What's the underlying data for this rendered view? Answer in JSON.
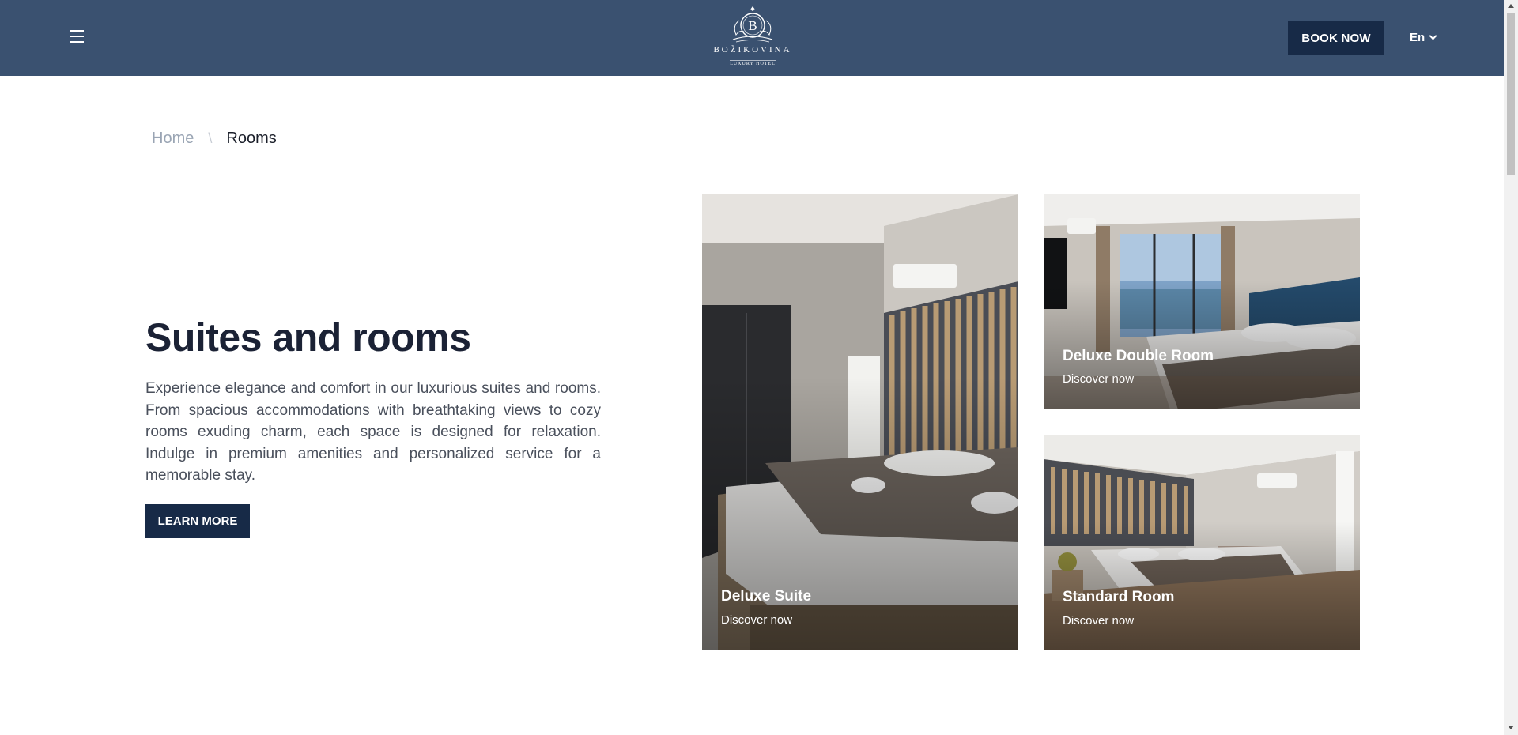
{
  "header": {
    "menu_icon": "hamburger-menu-icon",
    "logo": {
      "monogram": "B",
      "name": "BOŽIKOVINA",
      "tagline": "LUXURY HOTEL"
    },
    "book_label": "BOOK NOW",
    "language": "En",
    "colors": {
      "bar": "#3a5170",
      "button": "#172a47"
    }
  },
  "breadcrumb": {
    "home": "Home",
    "separator": "\\",
    "current": "Rooms"
  },
  "intro": {
    "title": "Suites and rooms",
    "description": "Experience elegance and comfort in our luxurious suites and rooms. From spacious accommodations with breathtaking views to cozy rooms exuding charm, each space is designed for relaxation. Indulge in premium amenities and personalized service for a memorable stay.",
    "button_label": "LEARN MORE"
  },
  "rooms": [
    {
      "title": "Deluxe Suite",
      "link": "Discover now"
    },
    {
      "title": "Deluxe Double Room",
      "link": "Discover now"
    },
    {
      "title": "Standard Room",
      "link": "Discover now"
    }
  ]
}
